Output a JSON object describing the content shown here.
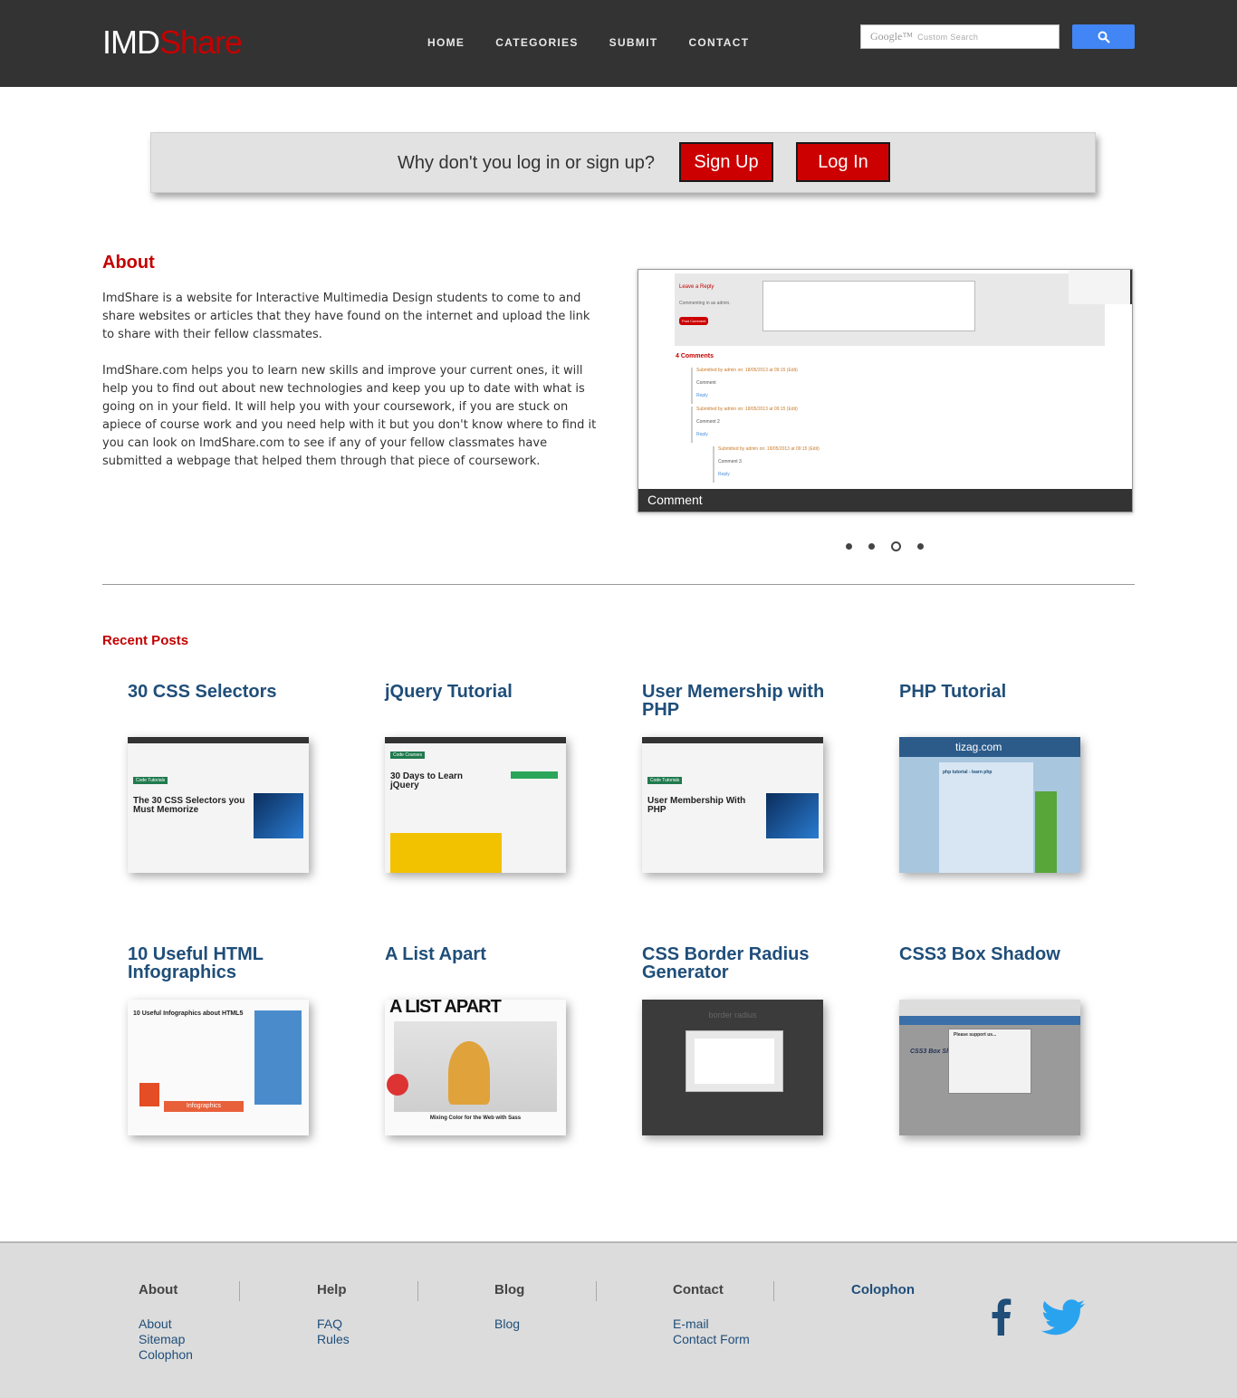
{
  "header": {
    "logo_part1": "IMD",
    "logo_part2": "Share",
    "nav": [
      "HOME",
      "CATEGORIES",
      "SUBMIT",
      "CONTACT"
    ],
    "search_brand": "Google™",
    "search_placeholder": "Custom Search",
    "search_icon": "magnifier-icon"
  },
  "login_bar": {
    "question": "Why don't you log in or sign up?",
    "signup_label": "Sign Up",
    "login_label": "Log In"
  },
  "about": {
    "title": "About",
    "paragraph1": "ImdShare is a website for Interactive Multimedia Design students to come to and share websites or articles that they have found on the internet and upload the link to share with their fellow classmates.",
    "paragraph2": "ImdShare.com helps you to learn new skills and improve your current ones, it will help you to find out about new technologies and keep you up to date with what is going on in your field. It will help you with your coursework, if you are stuck on apiece of course work and you need help with it but you don't know where to find it you can look on ImdShare.com to see if any of your fellow classmates have submitted a webpage that helped them through that piece of coursework."
  },
  "slider": {
    "caption": "Comment",
    "slide": {
      "leave_reply": "Leave a Reply",
      "commenting_as": "Commenting in as admin.",
      "post_comment": "Post Comment",
      "comments_count": "4 Comments",
      "comments": [
        {
          "meta": "Submitted by admin on: 18/05/2013 at 09:15 (Edit)",
          "text": "Comment",
          "reply": "Reply"
        },
        {
          "meta": "Submitted by admin on: 18/05/2013 at 09:15 (Edit)",
          "text": "Comment 2",
          "reply": "Reply"
        },
        {
          "meta": "Submitted by admin on: 18/05/2013 at 09:15 (Edit)",
          "text": "Comment 3",
          "reply": "Reply"
        }
      ]
    },
    "dots": 4,
    "active_dot": 3
  },
  "recent": {
    "title": "Recent Posts",
    "posts": [
      {
        "title": "30 CSS Selectors",
        "thumb_text": "The 30 CSS Selectors you Must Memorize",
        "thumb_tag": "Code Tutorials"
      },
      {
        "title": "jQuery Tutorial",
        "thumb_text": "30 Days to Learn jQuery",
        "thumb_tag": "Code Courses"
      },
      {
        "title": "User Memership with PHP",
        "thumb_text": "User Membership With PHP",
        "thumb_tag": "Code Tutorials"
      },
      {
        "title": "PHP Tutorial",
        "thumb_text": "tizag.com",
        "thumb_tag": "php tutorial - learn php"
      },
      {
        "title": "10 Useful HTML Infographics",
        "thumb_text": "10 Useful Infographics about HTML5",
        "thumb_tag": "Infographics"
      },
      {
        "title": "A List Apart",
        "thumb_text": "A LIST APART",
        "thumb_tag": "Mixing Color for the Web with Sass"
      },
      {
        "title": "CSS Border Radius Generator",
        "thumb_text": "border radius",
        "thumb_tag": ""
      },
      {
        "title": "CSS3 Box Shadow",
        "thumb_text": "CSS3 Box Shadow",
        "thumb_tag": "Please support us..."
      }
    ]
  },
  "footer": {
    "columns": [
      {
        "head": "About",
        "links": [
          "About",
          "Sitemap",
          "Colophon"
        ]
      },
      {
        "head": "Help",
        "links": [
          "FAQ",
          "Rules"
        ]
      },
      {
        "head": "Blog",
        "links": [
          "Blog"
        ]
      },
      {
        "head": "Contact",
        "links": [
          "E-mail",
          "Contact Form"
        ]
      },
      {
        "head": "Colophon",
        "links": []
      }
    ],
    "social": [
      "facebook-icon",
      "twitter-icon"
    ]
  },
  "colors": {
    "header_bg": "#333333",
    "brand_red": "#c40000",
    "link_blue": "#1f4e79",
    "search_blue": "#4285f4",
    "footer_bg": "#dcdcdc"
  }
}
